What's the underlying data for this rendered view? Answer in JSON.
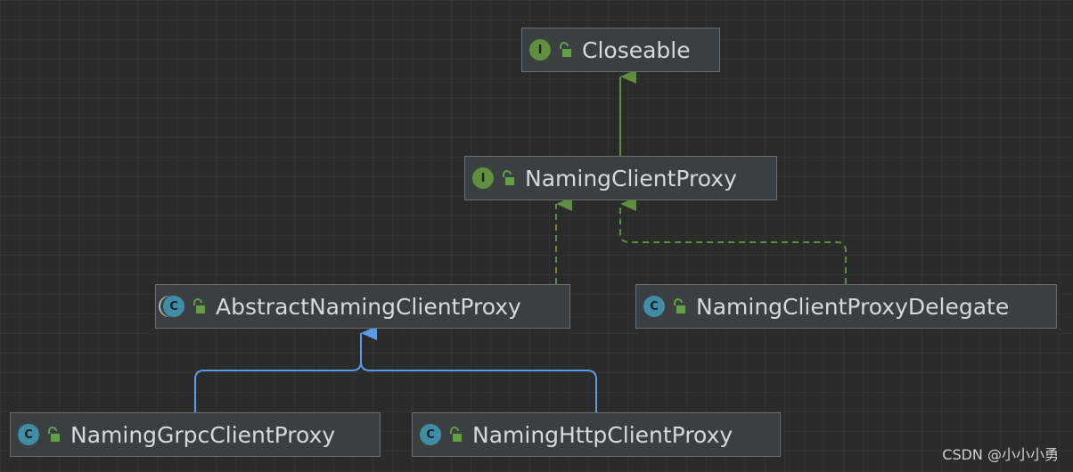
{
  "nodes": {
    "closeable": {
      "kind": "I",
      "name": "Closeable"
    },
    "naming_client_proxy": {
      "kind": "I",
      "name": "NamingClientProxy"
    },
    "abstract_naming_client_proxy": {
      "kind": "C",
      "name": "AbstractNamingClientProxy"
    },
    "naming_client_proxy_delegate": {
      "kind": "C",
      "name": "NamingClientProxyDelegate"
    },
    "naming_grpc_client_proxy": {
      "kind": "C",
      "name": "NamingGrpcClientProxy"
    },
    "naming_http_client_proxy": {
      "kind": "C",
      "name": "NamingHttpClientProxy"
    }
  },
  "edges": [
    {
      "from": "naming_client_proxy",
      "to": "closeable",
      "type": "extends"
    },
    {
      "from": "abstract_naming_client_proxy",
      "to": "naming_client_proxy",
      "type": "implements"
    },
    {
      "from": "naming_client_proxy_delegate",
      "to": "naming_client_proxy",
      "type": "implements"
    },
    {
      "from": "naming_grpc_client_proxy",
      "to": "abstract_naming_client_proxy",
      "type": "extends"
    },
    {
      "from": "naming_http_client_proxy",
      "to": "abstract_naming_client_proxy",
      "type": "extends"
    }
  ],
  "colors": {
    "background": "#2b2b2b",
    "node_fill": "#3c3f41",
    "node_border": "#6b6e70",
    "interface_arrow": "#5e8f3f",
    "class_arrow": "#5a9ae6",
    "interface_badge": "#5e8f3f",
    "class_badge": "#3f8da6"
  },
  "watermark": "CSDN @小小小勇"
}
